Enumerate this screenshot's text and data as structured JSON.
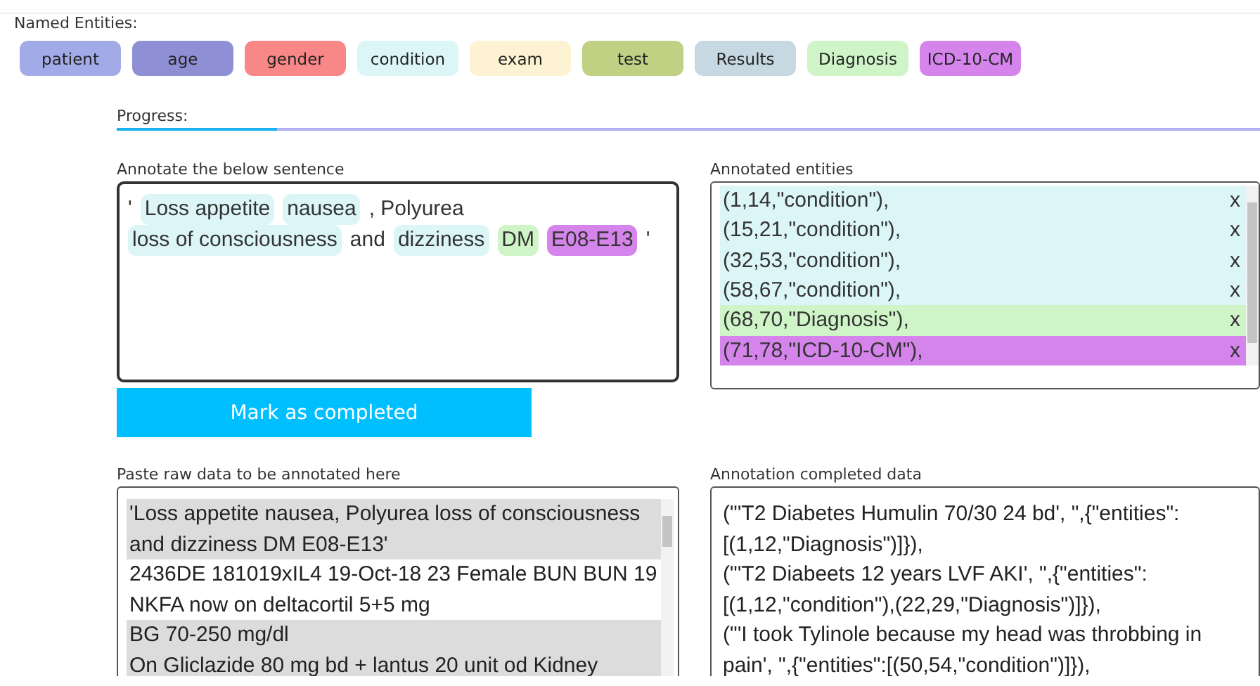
{
  "entities_label": "Named Entities:",
  "entities": [
    {
      "label": "patient",
      "color": "#a3aae8"
    },
    {
      "label": "age",
      "color": "#8f8fd6"
    },
    {
      "label": "gender",
      "color": "#f88787"
    },
    {
      "label": "condition",
      "color": "#dcf6f8"
    },
    {
      "label": "exam",
      "color": "#fdf3d2"
    },
    {
      "label": "test",
      "color": "#c0d184"
    },
    {
      "label": "Results",
      "color": "#c6d8e2"
    },
    {
      "label": "Diagnosis",
      "color": "#cff4c8"
    },
    {
      "label": "ICD-10-CM",
      "color": "#d584ec"
    }
  ],
  "progress": {
    "label": "Progress:",
    "level": 0.14
  },
  "sentence": {
    "label": "Annotate the below sentence",
    "segments": [
      {
        "text": "'"
      },
      {
        "text": "Loss appetite",
        "color": "#dcf6f8"
      },
      {
        "text": "nausea",
        "color": "#dcf6f8"
      },
      {
        "text": ", Polyurea"
      },
      {
        "text": "loss of consciousness",
        "color": "#dcf6f8"
      },
      {
        "text": "and"
      },
      {
        "text": "dizziness",
        "color": "#dcf6f8"
      },
      {
        "text": "DM",
        "color": "#cff4c8"
      },
      {
        "text": "E08-E13",
        "color": "#d584ec"
      },
      {
        "text": "'"
      }
    ]
  },
  "annotated": {
    "label": "Annotated entities",
    "rows": [
      {
        "text": "(1,14,\"condition\"),",
        "remove": "x",
        "color": "#dcf6f8"
      },
      {
        "text": "(15,21,\"condition\"),",
        "remove": "x",
        "color": "#dcf6f8"
      },
      {
        "text": "(32,53,\"condition\"),",
        "remove": "x",
        "color": "#dcf6f8"
      },
      {
        "text": "(58,67,\"condition\"),",
        "remove": "x",
        "color": "#dcf6f8"
      },
      {
        "text": "(68,70,\"Diagnosis\"),",
        "remove": "x",
        "color": "#cff4c8"
      },
      {
        "text": "(71,78,\"ICD-10-CM\"),",
        "remove": "x",
        "color": "#d584ec"
      }
    ]
  },
  "complete_button": "Mark as completed",
  "raw": {
    "label": "Paste raw data to be annotated here",
    "items": [
      {
        "text": "'Loss appetite nausea, Polyurea loss of consciousness and dizziness DM E08-E13'",
        "shaded": true
      },
      {
        "text": "2436DE 181019xIL4 19-Oct-18 23 Female BUN BUN 19 NKFA now on deltacortil 5+5 mg",
        "shaded": false
      },
      {
        "text": "BG 70-250 mg/dl",
        "shaded": true
      },
      {
        "text": "On Gliclazide 80 mg bd + lantus 20 unit od Kidney",
        "shaded": true
      }
    ]
  },
  "completed": {
    "label": "Annotation completed data",
    "items": [
      "(\"'T2 Diabetes Humulin 70/30 24 bd', \",{\"entities\": [(1,12,\"Diagnosis\")]}),",
      "(\"'T2 Diabeets 12 years LVF AKI', \",{\"entities\": [(1,12,\"condition\"),(22,29,\"Diagnosis\")]}),",
      "(\"'I took Tylinole because my head was throbbing in pain', \",{\"entities\":[(50,54,\"condition\")]}),"
    ]
  }
}
